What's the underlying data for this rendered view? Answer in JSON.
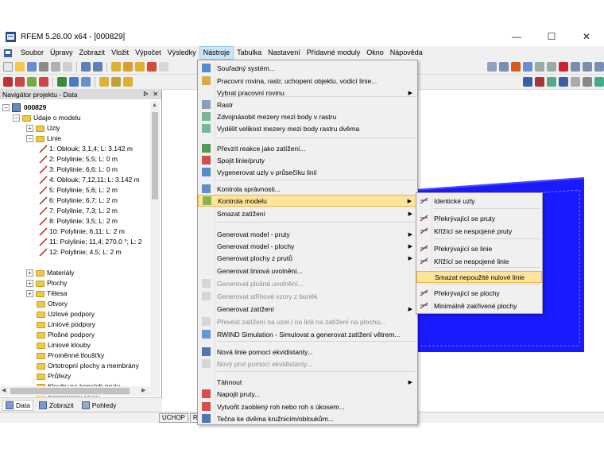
{
  "window": {
    "title": "RFEM 5.26.00 x64 - [000829]",
    "minimize": "—",
    "maximize": "☐",
    "close": "✕"
  },
  "menubar": {
    "items": [
      "Soubor",
      "Úpravy",
      "Zobrazit",
      "Vložit",
      "Výpočet",
      "Výsledky",
      "Nástroje",
      "Tabulka",
      "Nastavení",
      "Přídavné moduly",
      "Okno",
      "Nápověda"
    ],
    "active": "Nástroje"
  },
  "navigator": {
    "title": "Navigátor projektu - Data",
    "header_buttons": [
      "ᐅ",
      "✕"
    ],
    "project": "000829",
    "model_data": "Údaje o modelu",
    "nodes": "Uzly",
    "lines_folder": "Linie",
    "lines": [
      "1: Oblouk; 3,1,4; L: 3.142 m",
      "2: Polylinie; 5,5; L: 0 m",
      "3: Polylinie; 6,6; L: 0 m",
      "4: Oblouk; 7,12,11; L: 3.142 m",
      "5: Polylinie; 5,6; L: 2 m",
      "6: Polylinie; 6,7; L: 2 m",
      "7: Polylinie; 7,3; L: 2 m",
      "8: Polylinie; 3,5; L: 2 m",
      "10: Polylinie; 6,11; L: 2 m",
      "11: Polylinie; 11,4; 270.0 °; L: 2",
      "12: Polylinie; 4,5; L: 2 m"
    ],
    "other_folders": [
      "Materiály",
      "Plochy",
      "Tělesa"
    ],
    "flat_folders": [
      "Otvory",
      "Uzlové podpory",
      "Liniové podpory",
      "Plošné podpory",
      "Liniové klouby",
      "Proměnné tloušťky",
      "Ortotropní plochy a membrány",
      "Průřezy",
      "Klouby na koncích prutu",
      "Excentricity prutu"
    ],
    "tabs": [
      "Data",
      "Zobrazit",
      "Pohledy"
    ]
  },
  "status": {
    "cells": [
      "UCHOP",
      "RAS"
    ]
  },
  "tools_menu": {
    "items": [
      {
        "label": "Souřadný systém...",
        "disabled": false
      },
      {
        "label": "Pracovní rovina, rastr, uchopení objektu, vodicí linie...",
        "disabled": false
      },
      {
        "label": "Vybrat pracovní rovinu",
        "disabled": false,
        "sub": true
      },
      {
        "label": "Rastr",
        "disabled": false
      },
      {
        "label": "Zdvojnásobit mezery mezi body v rastru",
        "disabled": false
      },
      {
        "label": "Vydělit velikost mezery mezi body rastru dvěma",
        "disabled": false
      },
      {
        "label": "Převzít reakce jako zatížení...",
        "disabled": false
      },
      {
        "label": "Spojit linie/pruty",
        "disabled": false
      },
      {
        "label": "Vygenerovat uzly v průsečíku linií",
        "disabled": false
      },
      {
        "label": "Kontrola správnosti...",
        "disabled": false
      },
      {
        "label": "Kontrola modelu",
        "disabled": false,
        "sub": true,
        "highlight": true
      },
      {
        "label": "Smazat zatížení",
        "disabled": false,
        "sub": true
      },
      {
        "label": "Generovat model - pruty",
        "disabled": false,
        "sub": true
      },
      {
        "label": "Generovat model - plochy",
        "disabled": false,
        "sub": true
      },
      {
        "label": "Generovat plochy z prutů",
        "disabled": false,
        "sub": true
      },
      {
        "label": "Generovat liniová uvolnění...",
        "disabled": false
      },
      {
        "label": "Generovat plošná uvolnění...",
        "disabled": true
      },
      {
        "label": "Generovat střihové vzory z buněk",
        "disabled": true
      },
      {
        "label": "Generovat zatížení",
        "disabled": false,
        "sub": true
      },
      {
        "label": "Převést zatížení na uzel / na linii na zatížení na plochu...",
        "disabled": true
      },
      {
        "label": "RWIND Simulation - Simulovat a generovat zatížení větrem...",
        "disabled": false
      },
      {
        "label": "Nová linie pomocí ekvidistanty...",
        "disabled": false
      },
      {
        "label": "Nový prut pomocí ekvidistanty...",
        "disabled": true
      },
      {
        "label": "Táhnout",
        "disabled": false,
        "sub": true
      },
      {
        "label": "Napojit pruty...",
        "disabled": false
      },
      {
        "label": "Vytvořit zaoblený roh nebo roh s úkosem...",
        "disabled": false
      },
      {
        "label": "Tečna ke dvěma kružnicím/obloukům...",
        "disabled": false
      }
    ]
  },
  "model_check_submenu": {
    "items": [
      {
        "label": "Identické uzly"
      },
      {
        "label": "Překrývající se pruty"
      },
      {
        "label": "Křížící se nespojené pruty"
      },
      {
        "label": "Překrývající se linie"
      },
      {
        "label": "Křížící se nespojené linie"
      },
      {
        "label": "Smazat nepoužité nulové linie",
        "highlight": true
      },
      {
        "label": "Překrývající se plochy"
      },
      {
        "label": "Minimálně zakřivené plochy"
      }
    ]
  },
  "colors": {
    "menu_highlight": "#ffe49a",
    "model_blue": "#1a1aff"
  }
}
